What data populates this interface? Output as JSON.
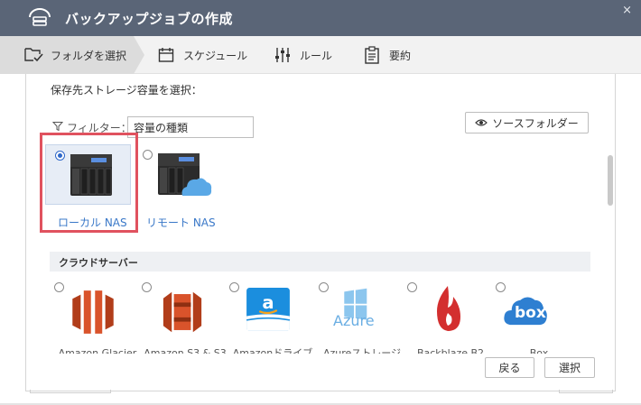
{
  "window": {
    "title": "バックアップジョブの作成",
    "close": "×"
  },
  "steps": [
    {
      "label": "フォルダを選択",
      "icon": "folder-select-icon",
      "active": true
    },
    {
      "label": "スケジュール",
      "icon": "calendar-icon",
      "active": false
    },
    {
      "label": "ルール",
      "icon": "sliders-icon",
      "active": false
    },
    {
      "label": "要約",
      "icon": "clipboard-icon",
      "active": false
    }
  ],
  "content": {
    "heading": "保存先ストレージ容量を選択：",
    "filter_label": "フィルター：",
    "filter_value": "容量の種類",
    "source_button": "ソースフォルダー"
  },
  "nas": [
    {
      "label": "ローカル NAS",
      "selected": true
    },
    {
      "label": "リモート NAS",
      "selected": false
    }
  ],
  "cloud_section": {
    "title": "クラウドサーバー",
    "items": [
      {
        "name": "Amazon Glacier",
        "icon": "amazon-glacier-icon"
      },
      {
        "name": "Amazon S3 & S3",
        "icon": "amazon-s3-icon"
      },
      {
        "name": "Amazonドライブ",
        "icon": "amazon-drive-icon"
      },
      {
        "name": "Azureストレージ",
        "icon": "azure-icon",
        "logo_text": "Azure"
      },
      {
        "name": "Backblaze B2",
        "icon": "backblaze-icon"
      },
      {
        "name": "Box",
        "icon": "box-icon",
        "logo_text": "box"
      }
    ]
  },
  "buttons": {
    "back": "戻る",
    "select": "選択"
  },
  "colors": {
    "titlebar": "#5a6577",
    "accent": "#2e67c9",
    "highlight": "#e0525f",
    "link": "#3a78c8"
  }
}
